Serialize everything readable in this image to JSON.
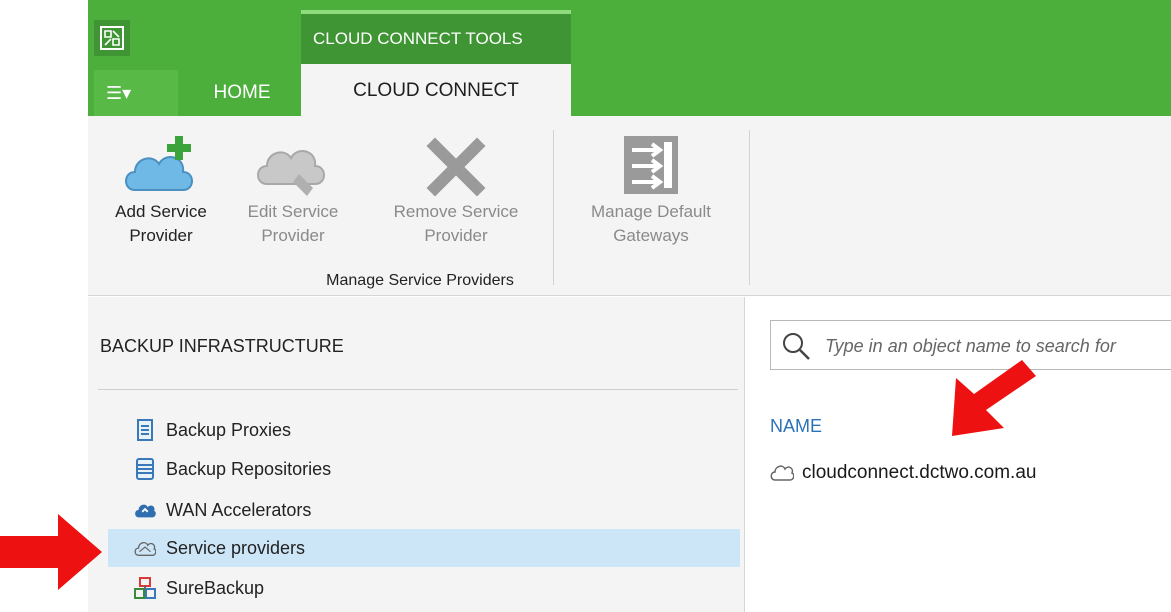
{
  "header": {
    "contextual_tab": "CLOUD CONNECT TOOLS",
    "menu_label": "☰▾",
    "tabs": [
      {
        "label": "HOME"
      },
      {
        "label": "CLOUD CONNECT"
      }
    ]
  },
  "ribbon": {
    "buttons": [
      {
        "line1": "Add Service",
        "line2": "Provider",
        "icon": "cloud-add-icon",
        "enabled": true
      },
      {
        "line1": "Edit Service",
        "line2": "Provider",
        "icon": "cloud-edit-icon",
        "enabled": false
      },
      {
        "line1": "Remove Service",
        "line2": "Provider",
        "icon": "remove-x-icon",
        "enabled": false
      },
      {
        "line1": "Manage Default",
        "line2": "Gateways",
        "icon": "gateways-icon",
        "enabled": false
      }
    ],
    "group_label": "Manage Service Providers"
  },
  "sidebar": {
    "title": "BACKUP INFRASTRUCTURE",
    "items": [
      {
        "label": "Backup Proxies",
        "icon": "server-icon"
      },
      {
        "label": "Backup Repositories",
        "icon": "database-icon"
      },
      {
        "label": "WAN Accelerators",
        "icon": "cloud-sync-icon"
      },
      {
        "label": "Service providers",
        "icon": "cloud-provider-icon",
        "selected": true
      },
      {
        "label": "SureBackup",
        "icon": "surebackup-icon"
      }
    ]
  },
  "main": {
    "search_placeholder": "Type in an object name to search for",
    "column_header": "NAME",
    "rows": [
      {
        "name": "cloudconnect.dctwo.com.au",
        "icon": "cloud-provider-icon"
      }
    ]
  },
  "colors": {
    "accent_green": "#4caf3c",
    "dark_green": "#3f9533",
    "selection": "#cde6f7",
    "link_blue": "#2b73b8",
    "annotation_red": "#ee1111"
  }
}
